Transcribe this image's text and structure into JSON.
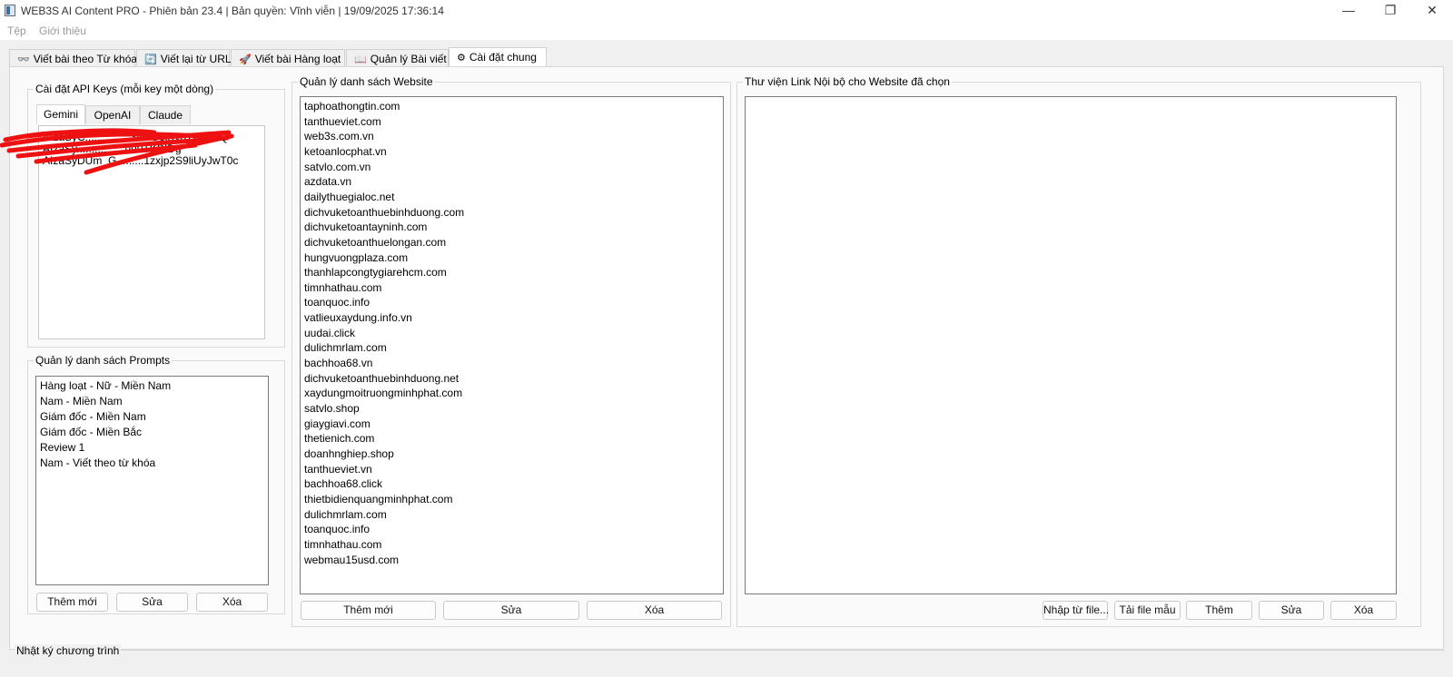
{
  "window": {
    "title": "WEB3S AI Content PRO - Phiên bản 23.4  |  Bản quyền: Vĩnh viễn  |  19/09/2025 17:36:14",
    "minimize": "—",
    "maximize": "❐",
    "close": "✕"
  },
  "menu": {
    "file": "Tệp",
    "about": "Giới thiệu"
  },
  "tabs": [
    {
      "icon": "👓",
      "label": "Viết bài theo Từ khóa"
    },
    {
      "icon": "🔄",
      "label": "Viết lại từ URL"
    },
    {
      "icon": "🚀",
      "label": "Viết bài Hàng loạt"
    },
    {
      "icon": "📖",
      "label": "Quản lý Bài viết"
    },
    {
      "icon": "⚙",
      "label": "Cài đặt chung"
    }
  ],
  "api_keys": {
    "title": "Cài đặt API Keys (mỗi key một dòng)",
    "tabs": [
      "Gemini",
      "OpenAI",
      "Claude"
    ],
    "keys": [
      "AIzaSyC...............3lnvG0lKyo1Z7ABQ",
      "AIzaSy................uu0TKBIDg",
      "AIzaSyDUm_G.........1zxjp2S9liUyJwT0c"
    ]
  },
  "prompts": {
    "title": "Quản lý danh sách Prompts",
    "items": [
      "Hàng loạt - Nữ - Miền Nam",
      "Nam - Miền Nam",
      "Giám đốc - Miền Nam",
      "Giám đốc - Miền Bắc",
      "Review 1",
      "Nam - Viết theo từ khóa"
    ],
    "add": "Thêm mới",
    "edit": "Sửa",
    "delete": "Xóa"
  },
  "websites": {
    "title": "Quản lý danh sách Website",
    "items": [
      "taphoathongtin.com",
      "tanthueviet.com",
      "web3s.com.vn",
      "ketoanlocphat.vn",
      "satvlo.com.vn",
      "azdata.vn",
      "dailythuegialoc.net",
      "dichvuketoanthuebinhduong.com",
      "dichvuketoantayninh.com",
      "dichvuketoanthuelongan.com",
      "hungvuongplaza.com",
      "thanhlapcongtygiarehcm.com",
      "timnhathau.com",
      "toanquoc.info",
      "vatlieuxaydung.info.vn",
      "uudai.click",
      "dulichmrlam.com",
      "bachhoa68.vn",
      "dichvuketoanthuebinhduong.net",
      "xaydungmoitruongminhphat.com",
      "satvlo.shop",
      "giaygiavi.com",
      "thetienich.com",
      "doanhnghiep.shop",
      "tanthueviet.vn",
      "bachhoa68.click",
      "thietbidienquangminhphat.com",
      "dulichmrlam.com",
      "toanquoc.info",
      "timnhathau.com",
      "webmau15usd.com"
    ],
    "add": "Thêm mới",
    "edit": "Sửa",
    "delete": "Xóa"
  },
  "links": {
    "title": "Thư viện Link Nội bộ cho Website đã chọn",
    "import": "Nhập từ file...",
    "template": "Tải file mẫu",
    "add": "Thêm",
    "edit": "Sửa",
    "delete": "Xóa"
  },
  "log": {
    "title": "Nhật ký chương trình"
  }
}
